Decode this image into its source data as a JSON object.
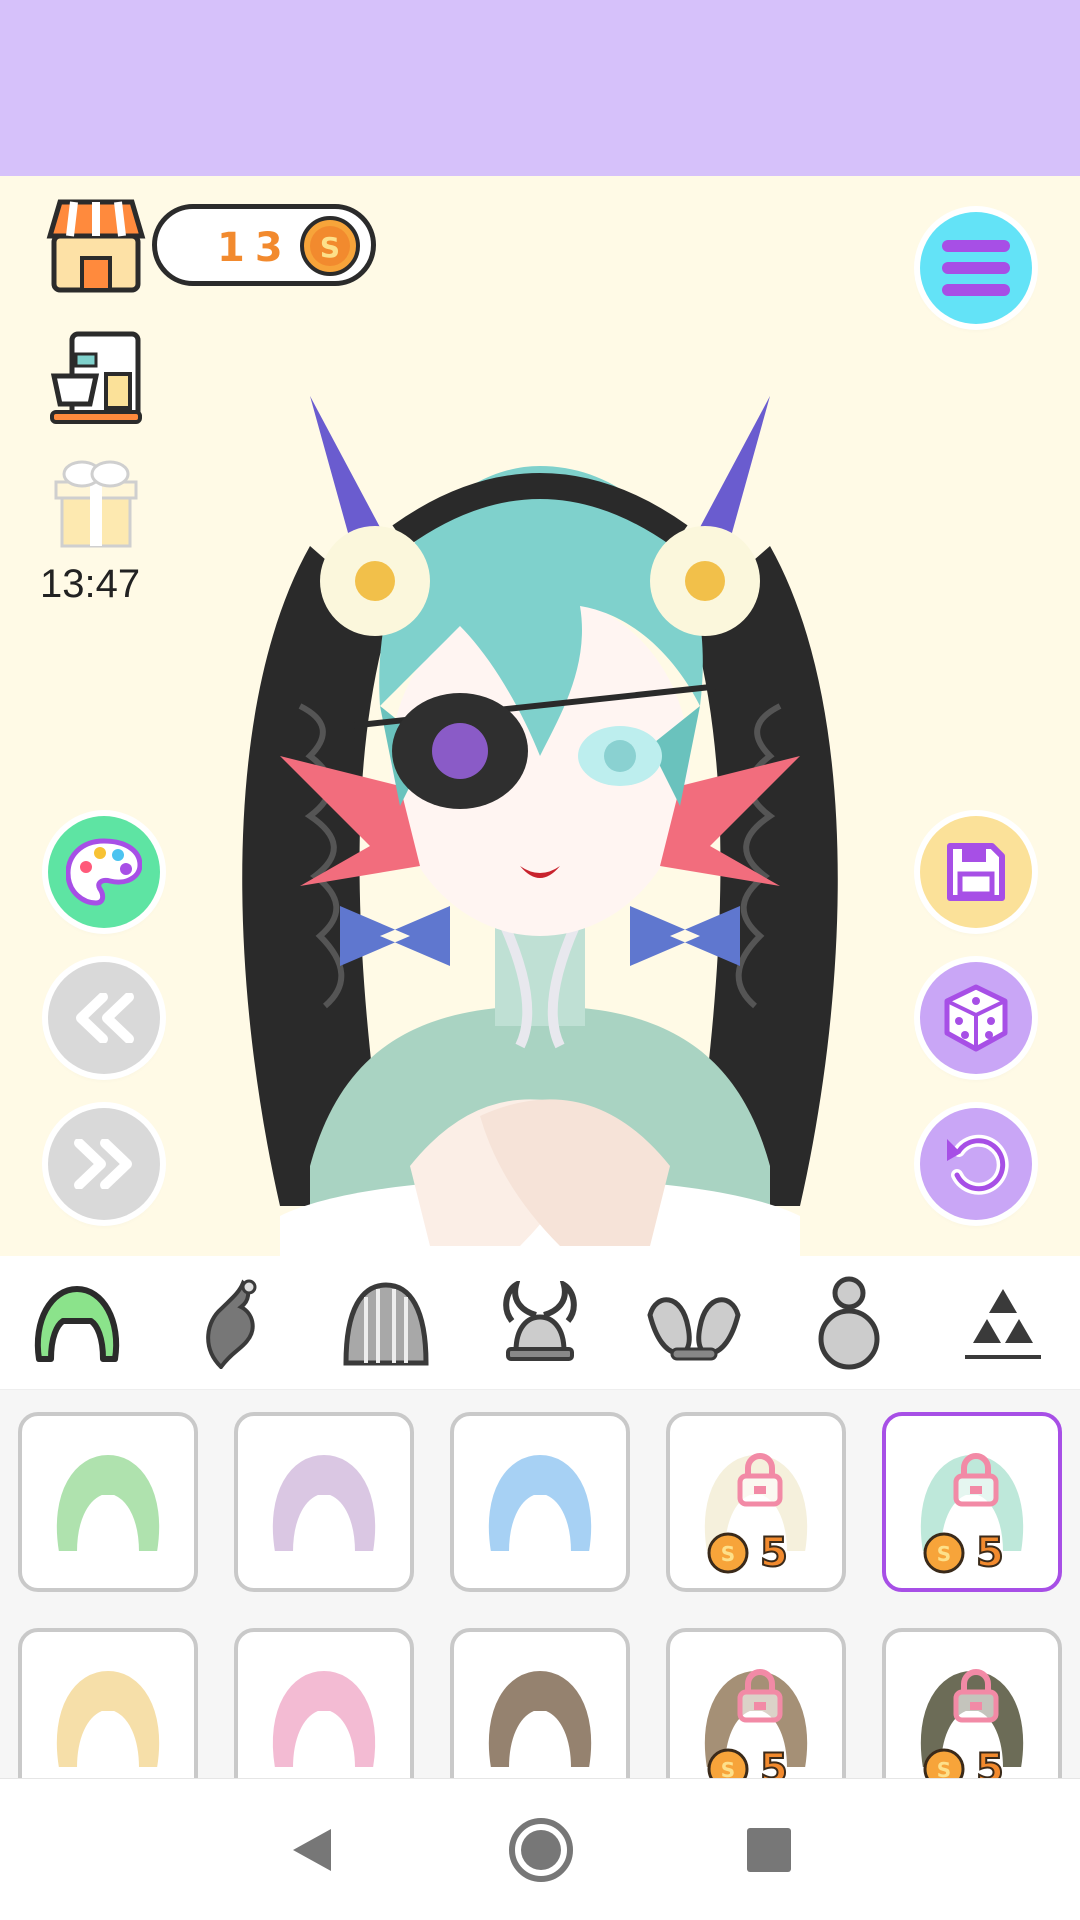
{
  "header": {
    "coins": "13",
    "coin_symbol": "S"
  },
  "sidebar": {
    "timer": "13:47"
  },
  "categories": [
    {
      "name": "hair-front"
    },
    {
      "name": "ahoge"
    },
    {
      "name": "hair-back"
    },
    {
      "name": "horns"
    },
    {
      "name": "ears"
    },
    {
      "name": "body"
    },
    {
      "name": "misc"
    }
  ],
  "items": [
    {
      "color": "#a7dfa6",
      "locked": false,
      "price": "",
      "selected": false
    },
    {
      "color": "#d6c2e0",
      "locked": false,
      "price": "",
      "selected": false
    },
    {
      "color": "#9ecdf3",
      "locked": false,
      "price": "",
      "selected": false
    },
    {
      "color": "#f4efd9",
      "locked": true,
      "price": "5",
      "selected": false
    },
    {
      "color": "#b8e6d6",
      "locked": true,
      "price": "5",
      "selected": true
    },
    {
      "color": "#f6dca0",
      "locked": false,
      "price": "",
      "selected": false
    },
    {
      "color": "#f2b4cf",
      "locked": false,
      "price": "",
      "selected": false
    },
    {
      "color": "#8a7560",
      "locked": false,
      "price": "",
      "selected": false
    },
    {
      "color": "#9c8468",
      "locked": true,
      "price": "5",
      "selected": false
    },
    {
      "color": "#5d5d45",
      "locked": true,
      "price": "5",
      "selected": false
    }
  ],
  "colors": {
    "banner": "#d6c1fa",
    "stage_bg": "#fffae6",
    "accent_purple": "#a74fe6",
    "coin_orange": "#f28a2e",
    "menu_cyan": "#63e3f7",
    "palette_green": "#5ee4a3",
    "save_yellow": "#fbe199",
    "dice_lilac": "#c9a6f6"
  }
}
